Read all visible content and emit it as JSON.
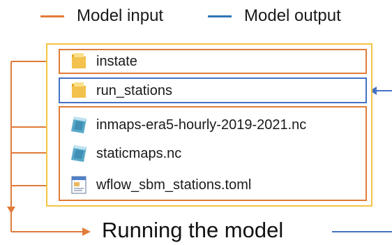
{
  "legend": {
    "input_label": "Model input",
    "output_label": "Model output",
    "input_color": "#e07b39",
    "output_color": "#2e75b6"
  },
  "files": [
    {
      "name": "instate",
      "icon": "folder-icon",
      "role": "input"
    },
    {
      "name": "run_stations",
      "icon": "folder-icon",
      "role": "output"
    },
    {
      "name": "inmaps-era5-hourly-2019-2021.nc",
      "icon": "netcdf-file-icon",
      "role": "input"
    },
    {
      "name": "staticmaps.nc",
      "icon": "netcdf-file-icon",
      "role": "input"
    },
    {
      "name": "wflow_sbm_stations.toml",
      "icon": "config-file-icon",
      "role": "input"
    }
  ],
  "run": {
    "label": "Running the model"
  },
  "colors": {
    "panel_border": "#f4c542",
    "folder": "#f2c14e"
  }
}
